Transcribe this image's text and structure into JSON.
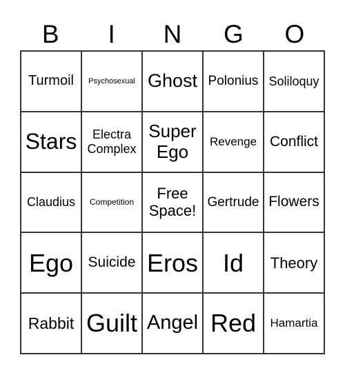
{
  "header": [
    "B",
    "I",
    "N",
    "G",
    "O"
  ],
  "cells": [
    "Turmoil",
    "Psychosexual",
    "Ghost",
    "Polonius",
    "Soliloquy",
    "Stars",
    "Electra Complex",
    "Super Ego",
    "Revenge",
    "Conflict",
    "Claudius",
    "Competition",
    "Free Space!",
    "Gertrude",
    "Flowers",
    "Ego",
    "Suicide",
    "Eros",
    "Id",
    "Theory",
    "Rabbit",
    "Guilt",
    "Angel",
    "Red",
    "Hamartia"
  ]
}
